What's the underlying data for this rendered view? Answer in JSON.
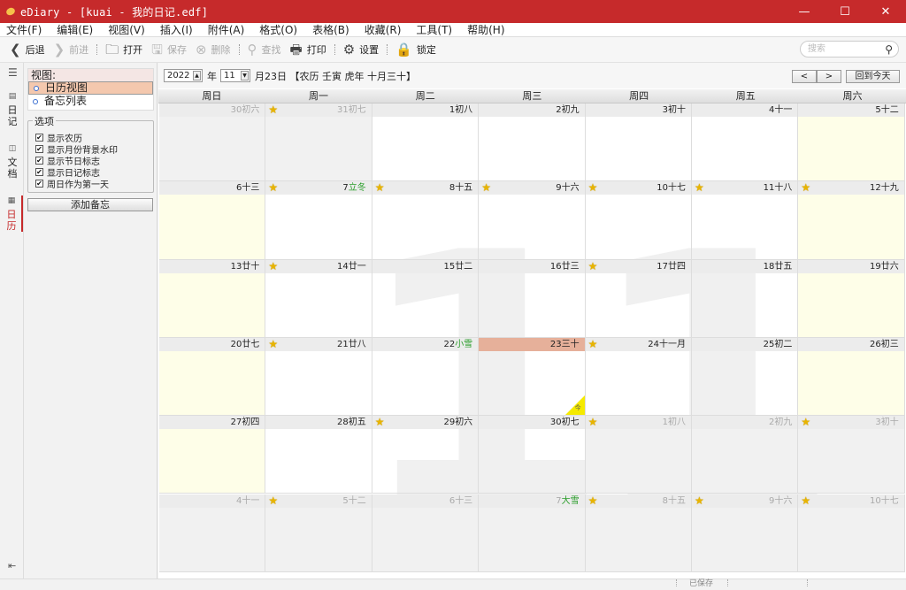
{
  "app": {
    "title": "eDiary - [kuai - 我的日记.edf]"
  },
  "menu": [
    "文件(F)",
    "编辑(E)",
    "视图(V)",
    "插入(I)",
    "附件(A)",
    "格式(O)",
    "表格(B)",
    "收藏(R)",
    "工具(T)",
    "帮助(H)"
  ],
  "toolbar": {
    "back": "后退",
    "forward": "前进",
    "open": "打开",
    "save": "保存",
    "delete": "删除",
    "find": "查找",
    "print": "打印",
    "settings": "设置",
    "lock": "锁定",
    "search_placeholder": "搜索"
  },
  "rail": {
    "diary": "日\n记",
    "docs": "文\n档",
    "calendar": "日\n历"
  },
  "panel": {
    "view_header": "视图:",
    "views": [
      "日历视图",
      "备忘列表"
    ],
    "options_label": "选项",
    "options": [
      "显示农历",
      "显示月份背景水印",
      "显示节日标志",
      "显示日记标志",
      "周日作为第一天"
    ],
    "add_memo": "添加备忘"
  },
  "calnav": {
    "year": "2022",
    "year_suffix": "年",
    "month": "11",
    "date_text": "月23日 【农历 壬寅 虎年 十月三十】",
    "prev": "<",
    "next": ">",
    "today": "回到今天"
  },
  "weekdays": [
    "周日",
    "周一",
    "周二",
    "周三",
    "周四",
    "周五",
    "周六"
  ],
  "watermark": "11",
  "weeks": [
    [
      {
        "d": "30",
        "l": "初六",
        "o": 1
      },
      {
        "d": "31",
        "l": "初七",
        "o": 1,
        "s": 1
      },
      {
        "d": "1",
        "l": "初八"
      },
      {
        "d": "2",
        "l": "初九"
      },
      {
        "d": "3",
        "l": "初十"
      },
      {
        "d": "4",
        "l": "十一"
      },
      {
        "d": "5",
        "l": "十二"
      }
    ],
    [
      {
        "d": "6",
        "l": "十三"
      },
      {
        "d": "7",
        "l": "立冬",
        "t": 1,
        "s": 1
      },
      {
        "d": "8",
        "l": "十五",
        "s": 1
      },
      {
        "d": "9",
        "l": "十六",
        "s": 1
      },
      {
        "d": "10",
        "l": "十七",
        "s": 1
      },
      {
        "d": "11",
        "l": "十八",
        "s": 1
      },
      {
        "d": "12",
        "l": "十九",
        "s": 1
      }
    ],
    [
      {
        "d": "13",
        "l": "廿十"
      },
      {
        "d": "14",
        "l": "廿一",
        "s": 1
      },
      {
        "d": "15",
        "l": "廿二"
      },
      {
        "d": "16",
        "l": "廿三"
      },
      {
        "d": "17",
        "l": "廿四",
        "s": 1
      },
      {
        "d": "18",
        "l": "廿五"
      },
      {
        "d": "19",
        "l": "廿六"
      }
    ],
    [
      {
        "d": "20",
        "l": "廿七"
      },
      {
        "d": "21",
        "l": "廿八",
        "s": 1
      },
      {
        "d": "22",
        "l": "小雪",
        "t": 1
      },
      {
        "d": "23",
        "l": "三十",
        "today": 1
      },
      {
        "d": "24",
        "l": "十一月",
        "s": 1
      },
      {
        "d": "25",
        "l": "初二"
      },
      {
        "d": "26",
        "l": "初三"
      }
    ],
    [
      {
        "d": "27",
        "l": "初四"
      },
      {
        "d": "28",
        "l": "初五"
      },
      {
        "d": "29",
        "l": "初六",
        "s": 1
      },
      {
        "d": "30",
        "l": "初七"
      },
      {
        "d": "1",
        "l": "初八",
        "o": 1,
        "s": 1
      },
      {
        "d": "2",
        "l": "初九",
        "o": 1
      },
      {
        "d": "3",
        "l": "初十",
        "o": 1,
        "s": 1
      }
    ],
    [
      {
        "d": "4",
        "l": "十一",
        "o": 1
      },
      {
        "d": "5",
        "l": "十二",
        "o": 1,
        "s": 1
      },
      {
        "d": "6",
        "l": "十三",
        "o": 1
      },
      {
        "d": "7",
        "l": "大雪",
        "o": 1,
        "t": 1
      },
      {
        "d": "8",
        "l": "十五",
        "o": 1,
        "s": 1
      },
      {
        "d": "9",
        "l": "十六",
        "o": 1,
        "s": 1
      },
      {
        "d": "10",
        "l": "十七",
        "o": 1,
        "s": 1
      }
    ]
  ],
  "today_badge": "今",
  "status": {
    "saved": "已保存"
  }
}
